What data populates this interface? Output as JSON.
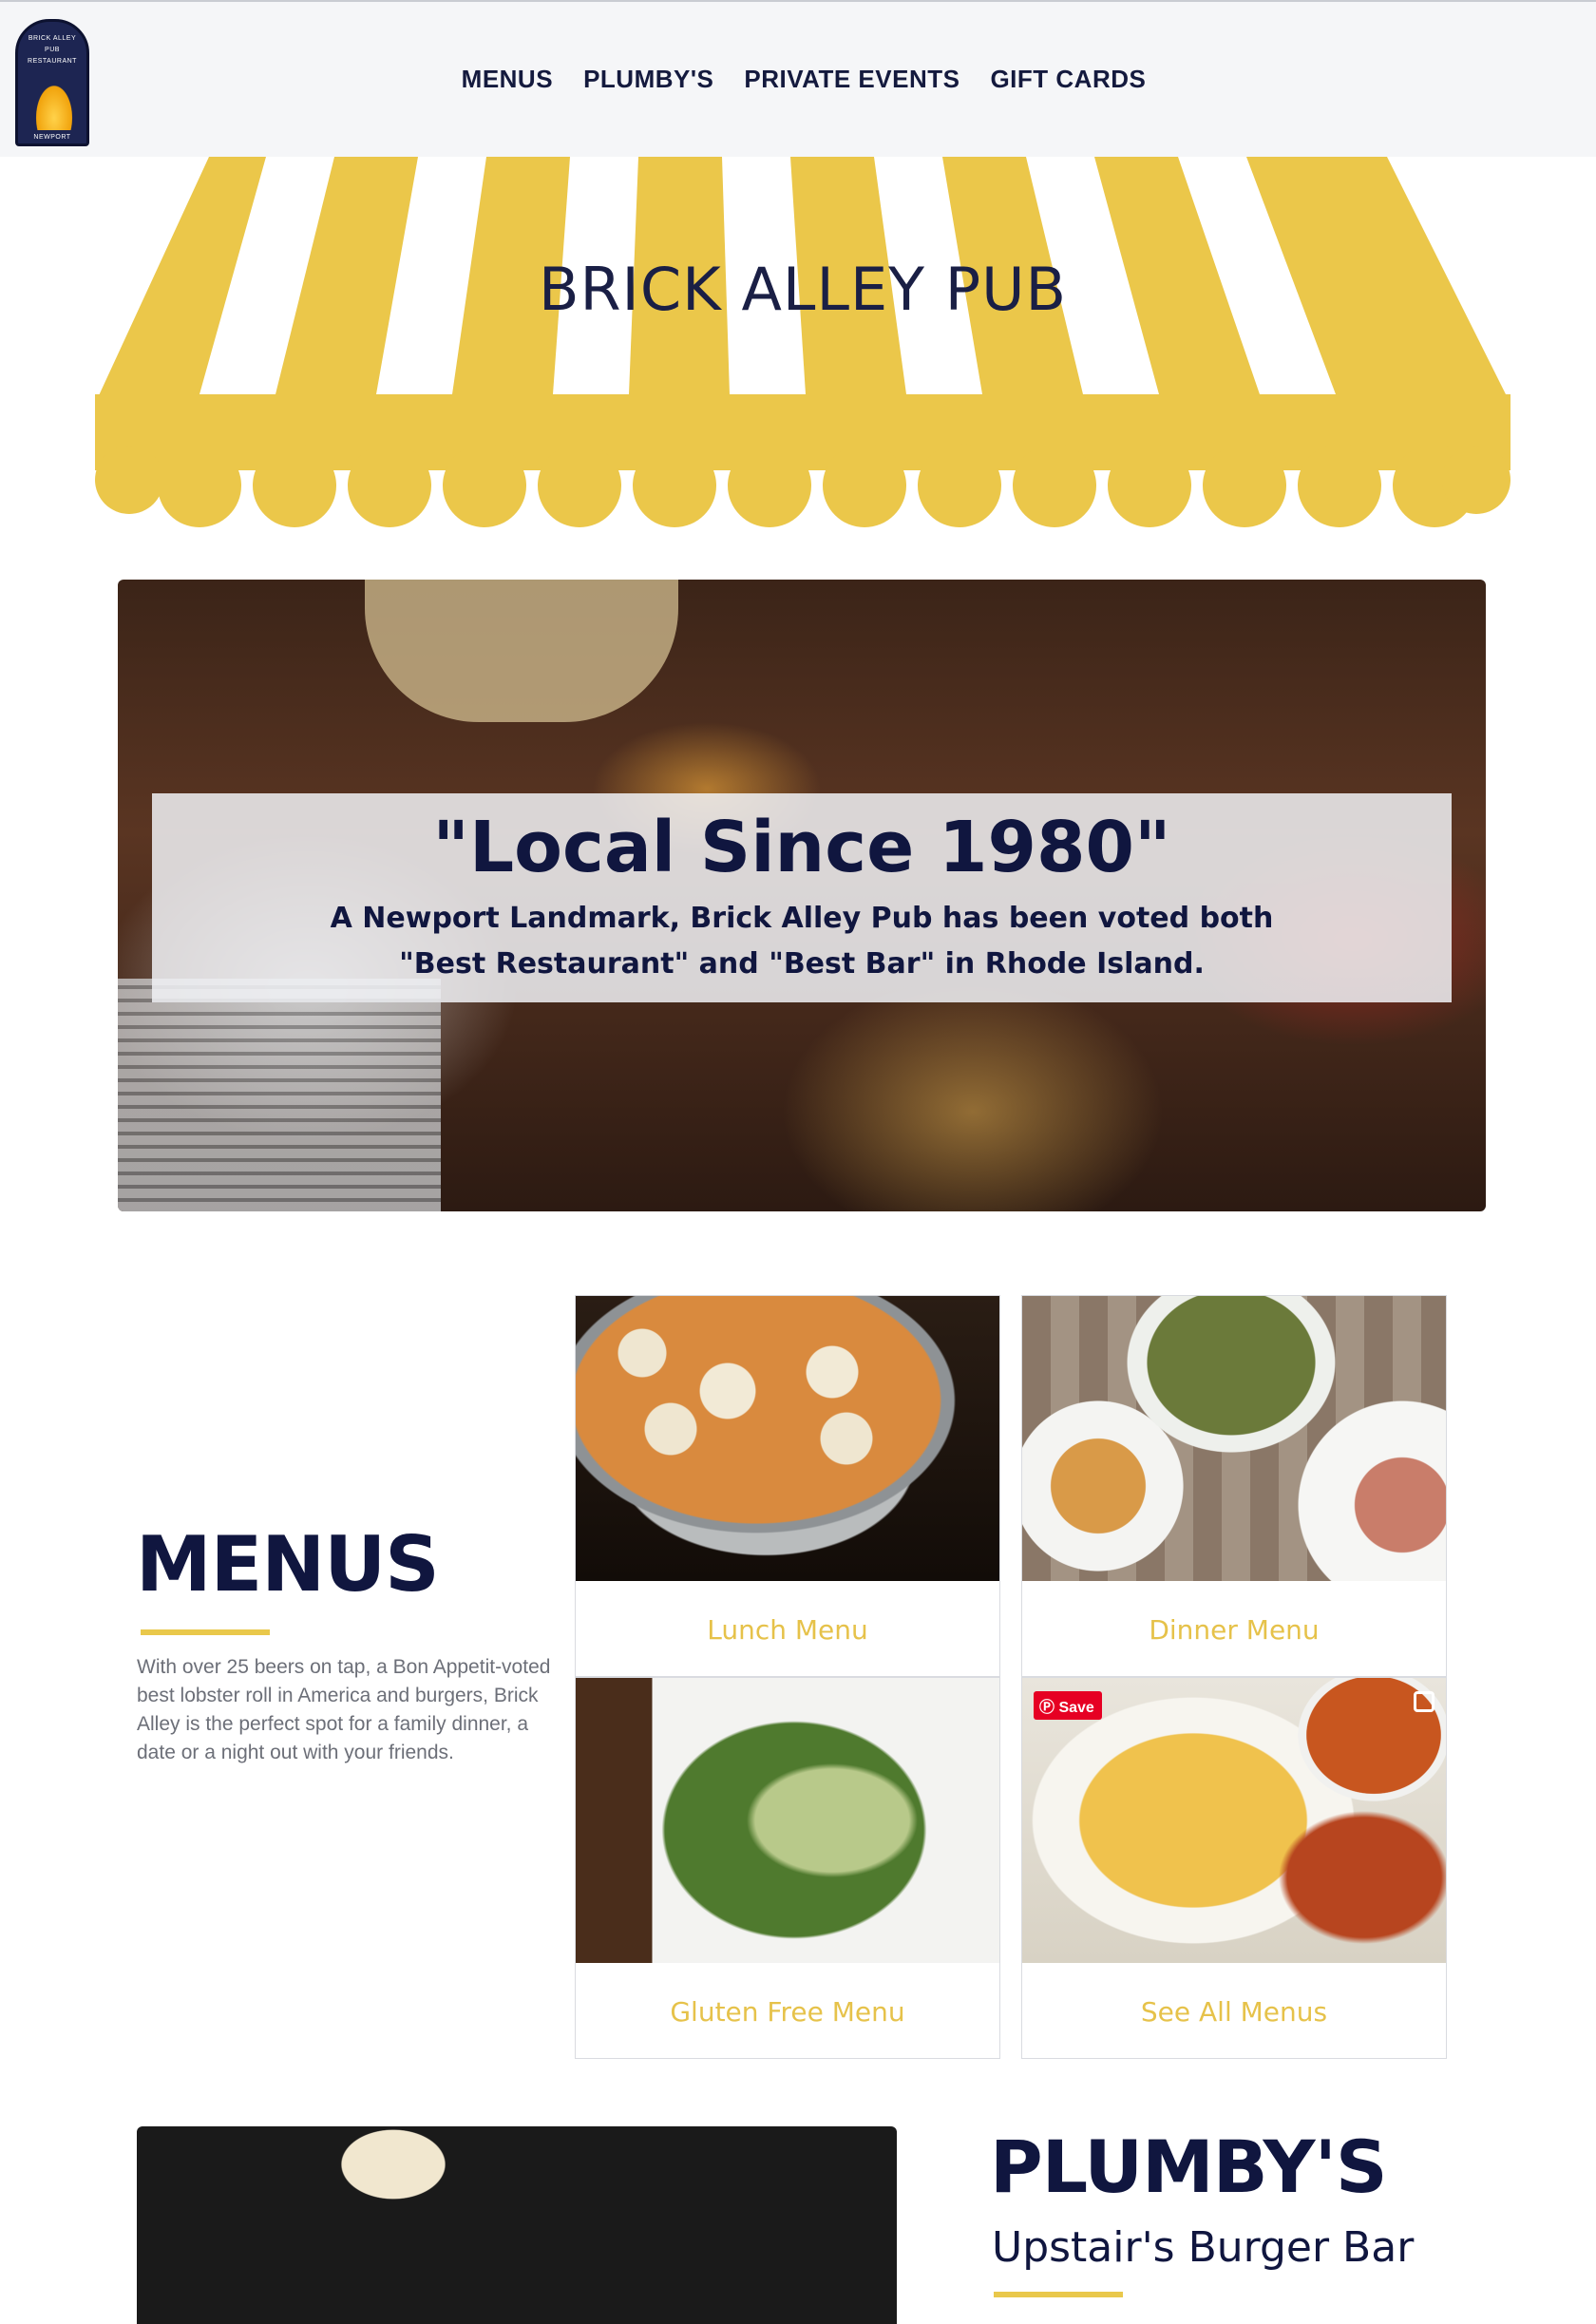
{
  "brand": {
    "logo_lines": [
      "BRICK ALLEY",
      "PUB",
      "RESTAURANT",
      "NEWPORT"
    ],
    "awning_title": "BRICK ALLEY PUB"
  },
  "nav": {
    "items": [
      "MENUS",
      "PLUMBY'S",
      "PRIVATE EVENTS",
      "GIFT CARDS"
    ]
  },
  "hero": {
    "title": "\"Local Since 1980\"",
    "subtitle": "A Newport Landmark, Brick Alley Pub has been voted both \"Best Restaurant\" and \"Best Bar\" in Rhode Island."
  },
  "menus": {
    "title": "MENUS",
    "description": "With over 25 beers on tap, a Bon Appetit-voted best lobster roll in America and burgers, Brick Alley is the perfect spot for a family dinner, a date or a night out with your friends.",
    "cards": [
      {
        "label": "Lunch Menu"
      },
      {
        "label": "Dinner Menu"
      },
      {
        "label": "Gluten Free Menu"
      },
      {
        "label": "See All Menus"
      }
    ],
    "save_badge": "Save"
  },
  "plumbys": {
    "title": "PLUMBY'S",
    "subtitle": "Upstair's Burger Bar"
  },
  "colors": {
    "accent_yellow": "#e9c84b",
    "navy": "#10163f",
    "header_bg": "#f5f6f8"
  },
  "icons": {
    "logo": "brick-alley-crest-logo",
    "pinterest": "pinterest-save-icon",
    "expand": "expand-icon"
  }
}
